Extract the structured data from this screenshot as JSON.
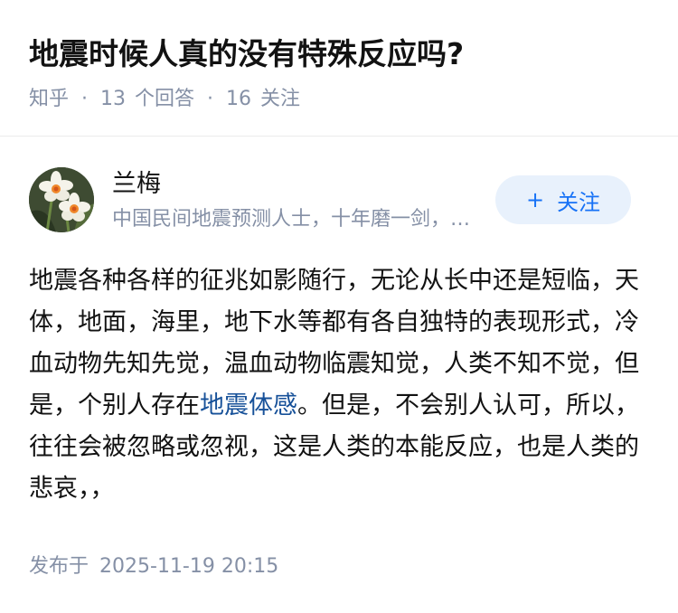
{
  "question": {
    "title": "地震时候人真的没有特殊反应吗?",
    "source": "知乎",
    "answers_count": "13",
    "answers_label": "个回答",
    "followers_count": "16",
    "followers_label": "关注",
    "separator": "·"
  },
  "author": {
    "name": "兰梅",
    "bio": "中国民间地震预测人士，十年磨一剑，只为一剑封喉",
    "avatar_icon": "narcissus-flower-avatar",
    "follow_icon": "plus-icon",
    "follow_symbol": "+",
    "follow_label": "关注"
  },
  "answer": {
    "text_before_link": "地震各种各样的征兆如影随行，无论从长中还是短临，天体，地面，海里，地下水等都有各自独特的表现形式，冷血动物先知先觉，温血动物临震知觉，人类不知不觉，但是，个别人存在",
    "link_text": "地震体感",
    "text_after_link": "。但是，不会别人认可，所以，往往会被忽略或忽视，这是人类的本能反应，也是人类的悲哀，，"
  },
  "publish": {
    "label": "发布于",
    "time": "2025-11-19 20:15"
  },
  "colors": {
    "link": "#175199",
    "meta": "#8590a6",
    "follow_bg": "#e8f1fc",
    "follow_text": "#1772f6"
  }
}
